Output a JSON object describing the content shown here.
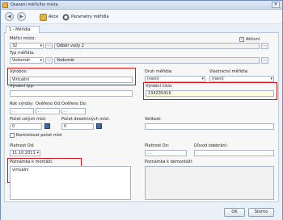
{
  "window": {
    "title": "Osazení měřícího místa",
    "close_glyph": "✕"
  },
  "toolbar": {
    "back_glyph": "◀",
    "forward_glyph": "▶",
    "actions_label": "Akce",
    "params_label": "Parametry měřidla"
  },
  "tabs": [
    {
      "label": "1 - Měřidla"
    }
  ],
  "form": {
    "merici_misto": {
      "label": "Měřící místo:",
      "code": "32",
      "name": "Odběr vody 2"
    },
    "aktivni": {
      "label": "Aktivní",
      "checked": true,
      "check_glyph": "✓"
    },
    "typ_meridla": {
      "label": "Typ měřidla:",
      "code": "Vodoměr",
      "name": "Vodoměr"
    },
    "vyrobce": {
      "label": "Výrobce:",
      "value": "Virtuální"
    },
    "druh_meridla": {
      "label": "Druh měřidla:",
      "value": "(není)"
    },
    "vlastnictvi": {
      "label": "Vlastnictví měřidla:",
      "value": "(není)"
    },
    "vyrobni_typ": {
      "label": "Výrobní typ:",
      "value": ""
    },
    "vyrobni_cislo": {
      "label": "Výrobní číslo:",
      "value": "134235416"
    },
    "rok_vyroby": {
      "label": "Rok výroby:",
      "value": " .  ."
    },
    "overeno_od": {
      "label": "Ověřeno Od:",
      "value": " .  ."
    },
    "overeno_do": {
      "label": "Ověřeno Do:",
      "value": " .  ."
    },
    "pocet_celych": {
      "label": "Počet celých míst:",
      "value": "0"
    },
    "pocet_desetinnych": {
      "label": "Počet desetinných míst:",
      "value": "0"
    },
    "velikost": {
      "label": "Velikost:",
      "value": ""
    },
    "kontrolovat": {
      "label": "Kontrolovat počet míst",
      "checked": false
    },
    "platnost_od": {
      "label": "Platnost Od:",
      "value": "11.10.2011"
    },
    "platnost_do": {
      "label": "Platnost Do:",
      "value": " .  ."
    },
    "duvod": {
      "label": "Důvod odebrání:",
      "value": ""
    },
    "poznamka_montaz": {
      "label": "Poznámka k montáži:",
      "value": "virtuální"
    },
    "poznamka_demontaz": {
      "label": "Poznámka k demontáži:",
      "value": ""
    },
    "ellipsis": "..."
  },
  "buttons": {
    "ok": "OK",
    "cancel": "Storno"
  },
  "colors": {
    "highlight": "#d9141b",
    "accent": "#3c6aa6"
  }
}
